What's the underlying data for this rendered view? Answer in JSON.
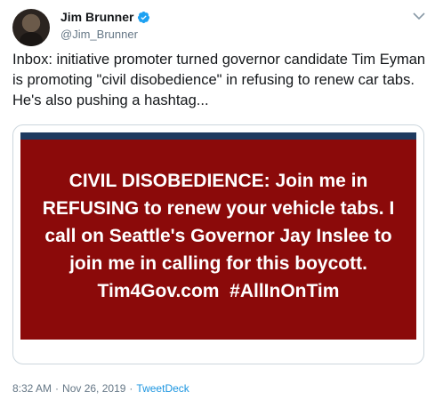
{
  "author": {
    "name": "Jim Brunner",
    "handle": "@Jim_Brunner",
    "verified": true,
    "avatar_icon": "profile-photo"
  },
  "tweet": {
    "text": "Inbox: initiative promoter turned governor candidate Tim Eyman is promoting \"civil disobedience\" in refusing to renew car tabs. He's also pushing a hashtag..."
  },
  "image": {
    "lines": [
      "CIVIL DISOBEDIENCE: Join me in",
      "REFUSING to renew your vehicle tabs. I",
      "call on Seattle's Governor Jay Inslee to",
      "join me in calling for this boycott.",
      "Tim4Gov.com  #AllInOnTim"
    ],
    "background_color": "#8b0a0a",
    "text_color": "#ffffff"
  },
  "meta": {
    "time": "8:32 AM",
    "date": "Nov 26, 2019",
    "separator": "·",
    "source": "TweetDeck"
  },
  "colors": {
    "verified": "#1da1f2",
    "link": "#1b95e0",
    "secondary_text": "#657786"
  }
}
